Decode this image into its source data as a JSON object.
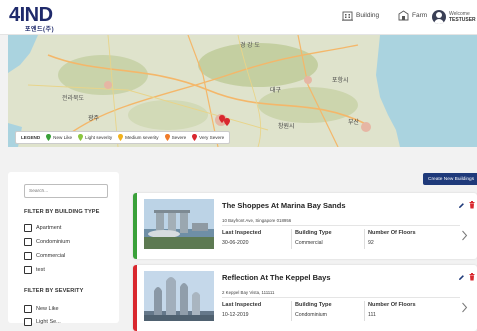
{
  "header": {
    "logo_main": "4IND",
    "logo_sub": "포엔드(주)",
    "nav": [
      {
        "label": "Building",
        "icon": "building-icon"
      },
      {
        "label": "Farm",
        "icon": "farm-icon"
      }
    ],
    "user": {
      "greeting": "Welcome",
      "name": "TESTUSER",
      "icon": "avatar-icon"
    }
  },
  "map": {
    "labels": [
      "경 강 도",
      "포항시",
      "대구",
      "부산",
      "창원시",
      "전라북도",
      "광주"
    ],
    "legend": {
      "title": "LEGEND",
      "items": [
        {
          "label": "New Like",
          "color": "#3aa13a"
        },
        {
          "label": "Light severity",
          "color": "#8cc63f"
        },
        {
          "label": "Medium severity",
          "color": "#f2b21c"
        },
        {
          "label": "Severe",
          "color": "#f07b2a"
        },
        {
          "label": "Very Severe",
          "color": "#d9282f"
        }
      ]
    }
  },
  "sidebar": {
    "search_placeholder": "Search...",
    "building_type_title": "FILTER BY BUILDING TYPE",
    "building_types": [
      "Apartment",
      "Condominium",
      "Commercial",
      "test"
    ],
    "severity_title": "FILTER BY SEVERITY",
    "severities": [
      "New Like",
      "Light Se..."
    ]
  },
  "create_button": "Create New Buildings",
  "field_labels": {
    "last_inspected": "Last Inspected",
    "building_type": "Building Type",
    "floors": "Number Of Floors"
  },
  "buildings": [
    {
      "name": "The Shoppes At Marina Bay Sands",
      "address": "10 Bayfront Ave, Singapore 018956",
      "last_inspected": "30-06-2020",
      "building_type": "Commercial",
      "floors": "92",
      "status_color": "#3aa13a"
    },
    {
      "name": "Reflection At The Keppel Bays",
      "address": "2 Keppel Bay Vista, 111111",
      "last_inspected": "10-12-2019",
      "building_type": "Condominium",
      "floors": "111",
      "status_color": "#d9282f"
    }
  ],
  "colors": {
    "brand": "#1f2a6b",
    "button": "#1f3a7a",
    "delete": "#d9282f",
    "edit": "#1f3a7a"
  }
}
